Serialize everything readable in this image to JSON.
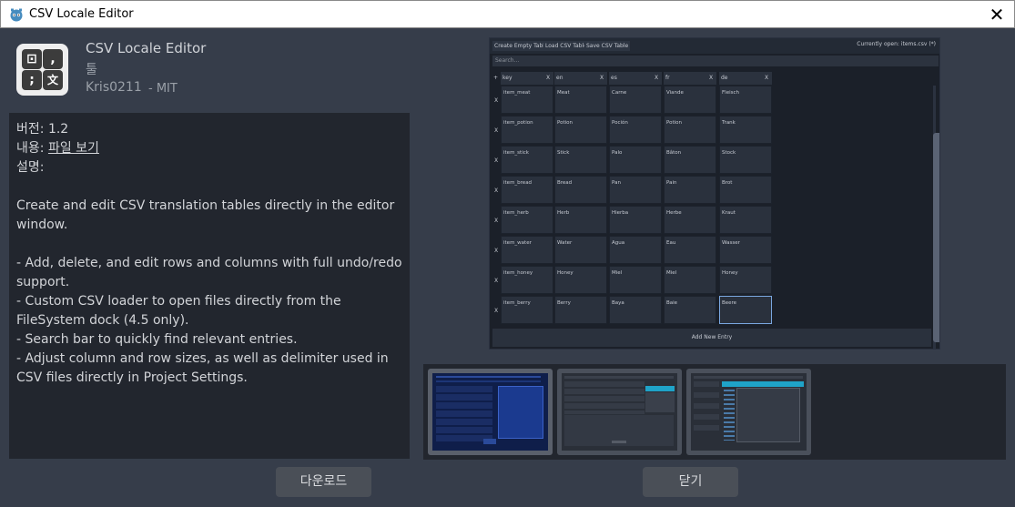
{
  "window": {
    "title": "CSV Locale Editor"
  },
  "plugin": {
    "name": "CSV Locale Editor",
    "category": "툴",
    "author": "Kris0211",
    "license": "MIT"
  },
  "details": {
    "version_label": "버전:",
    "version_value": "1.2",
    "content_label": "내용:",
    "content_link": "파일 보기",
    "description_label": "설명:",
    "paragraph1": "Create and edit CSV translation tables directly in the editor window.",
    "bullets": [
      "- Add, delete, and edit rows and columns with full undo/redo support.",
      "- Custom CSV loader to open files directly from the FileSystem dock (4.5 only).",
      "- Search bar to quickly find relevant entries.",
      "- Adjust column and row sizes, as well as delimiter used in CSV files directly in Project Settings."
    ]
  },
  "preview": {
    "buttons": [
      "Create Empty Table",
      "Load CSV Table",
      "Save CSV Table"
    ],
    "currently_open": "Currently open: items.csv (*)",
    "search_placeholder": "Search...",
    "columns": [
      "key",
      "en",
      "es",
      "fr",
      "de"
    ],
    "rows": [
      [
        "item_meat",
        "Meat",
        "Carne",
        "Viande",
        "Fleisch"
      ],
      [
        "item_potion",
        "Potion",
        "Poción",
        "Potion",
        "Trank"
      ],
      [
        "item_stick",
        "Stick",
        "Palo",
        "Bâton",
        "Stock"
      ],
      [
        "item_bread",
        "Bread",
        "Pan",
        "Pain",
        "Brot"
      ],
      [
        "item_herb",
        "Herb",
        "Hierba",
        "Herbe",
        "Kraut"
      ],
      [
        "item_water",
        "Water",
        "Agua",
        "Eau",
        "Wasser"
      ],
      [
        "item_honey",
        "Honey",
        "Miel",
        "Miel",
        "Honey"
      ],
      [
        "item_berry",
        "Berry",
        "Baya",
        "Baie",
        "Beere"
      ]
    ],
    "add_entry": "Add New Entry"
  },
  "actions": {
    "download": "다운로드",
    "close": "닫기"
  },
  "colors": {
    "background": "#363d4a",
    "panel": "#22262e",
    "button": "#4a4f57"
  }
}
